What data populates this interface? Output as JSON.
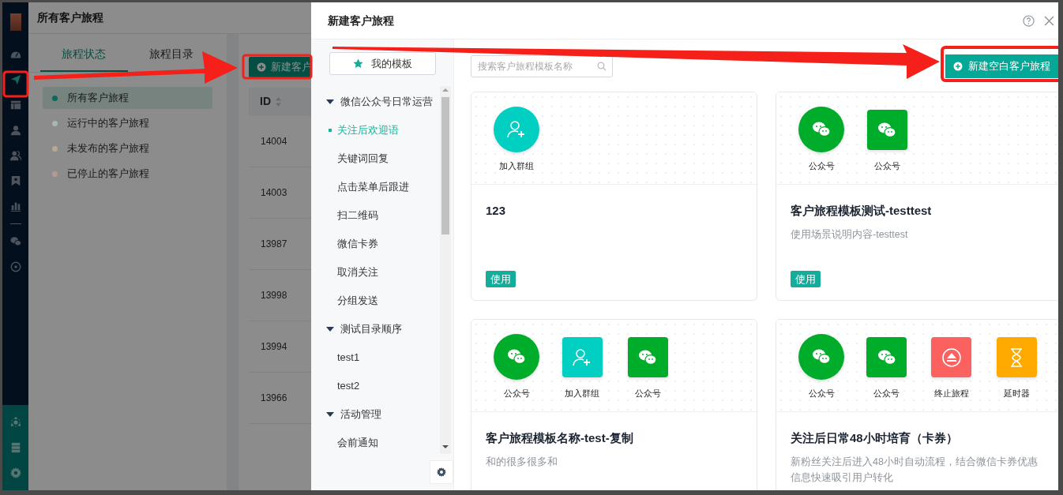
{
  "sidebar": {
    "top_items": [
      {
        "kind": "gauge",
        "selected": false
      },
      {
        "kind": "send",
        "selected": true
      },
      {
        "kind": "layout",
        "selected": false
      },
      {
        "kind": "user",
        "selected": false
      },
      {
        "kind": "users",
        "selected": false
      },
      {
        "kind": "bookmark",
        "selected": false
      },
      {
        "kind": "chart",
        "selected": false
      }
    ],
    "lower_items": [
      {
        "kind": "wechat",
        "selected": false
      },
      {
        "kind": "target",
        "selected": false
      }
    ],
    "bottom_items": [
      {
        "kind": "network",
        "selected": false
      },
      {
        "kind": "server",
        "selected": false
      },
      {
        "kind": "settings",
        "selected": false
      }
    ]
  },
  "page_title": "所有客户旅程",
  "tabs": [
    {
      "label": "旅程状态",
      "selected": true
    },
    {
      "label": "旅程目录",
      "selected": false
    }
  ],
  "status_list": [
    {
      "label": "所有客户旅程",
      "selected": true,
      "color": "#0b6a5c"
    },
    {
      "label": "运行中的客户旅程",
      "selected": false,
      "color": "#a8b8b0"
    },
    {
      "label": "未发布的客户旅程",
      "selected": false,
      "color": "#b7a991"
    },
    {
      "label": "已停止的客户旅程",
      "selected": false,
      "color": "#b39a94"
    }
  ],
  "new_button": "新建客户",
  "table": {
    "columns": [
      "ID"
    ],
    "rows": [
      [
        "14004"
      ],
      [
        "14003"
      ],
      [
        "13987"
      ],
      [
        "13998"
      ],
      [
        "13994"
      ],
      [
        "13966"
      ]
    ]
  },
  "modal": {
    "title": "新建客户旅程",
    "my_templates_button": "我的模板",
    "tree": [
      {
        "label": "微信公众号日常运营",
        "expanded": true,
        "children": [
          {
            "label": "关注后欢迎语",
            "selected": true
          },
          {
            "label": "关键词回复",
            "selected": false
          },
          {
            "label": "点击菜单后跟进",
            "selected": false
          },
          {
            "label": "扫二维码",
            "selected": false
          },
          {
            "label": "微信卡券",
            "selected": false
          },
          {
            "label": "取消关注",
            "selected": false
          },
          {
            "label": "分组发送",
            "selected": false
          }
        ]
      },
      {
        "label": "测试目录顺序",
        "expanded": true,
        "children": [
          {
            "label": "test1",
            "selected": false
          },
          {
            "label": "test2",
            "selected": false
          }
        ]
      },
      {
        "label": "活动管理",
        "expanded": true,
        "children": [
          {
            "label": "会前通知",
            "selected": false
          }
        ]
      }
    ],
    "search": {
      "placeholder": "搜索客户旅程模板名称"
    },
    "new_blank_button": "新建空白客户旅程",
    "templates": [
      {
        "nodes": [
          {
            "kind": "group",
            "round": true,
            "label": "加入群组"
          }
        ],
        "title": "123",
        "use_button": "使用"
      },
      {
        "nodes": [
          {
            "kind": "wechat",
            "round": true,
            "label": "公众号"
          },
          {
            "kind": "wechat",
            "round": false,
            "label": "公众号"
          }
        ],
        "title": "客户旅程模板测试-testtest",
        "description": "使用场景说明内容-testtest",
        "use_button": "使用"
      },
      {
        "nodes": [
          {
            "kind": "wechat",
            "round": true,
            "label": "公众号"
          },
          {
            "kind": "group",
            "round": false,
            "label": "加入群组"
          },
          {
            "kind": "wechat",
            "round": false,
            "label": "公众号"
          }
        ],
        "title": "客户旅程模板名称-test-复制",
        "description": "和的很多很多和"
      },
      {
        "nodes": [
          {
            "kind": "wechat",
            "round": true,
            "label": "公众号"
          },
          {
            "kind": "wechat",
            "round": false,
            "label": "公众号"
          },
          {
            "kind": "stop",
            "round": false,
            "label": "终止旅程"
          },
          {
            "kind": "timer",
            "round": false,
            "label": "延时器"
          }
        ],
        "title": "关注后日常48小时培育（卡券）",
        "description": "新粉丝关注后进入48小时自动流程，结合微信卡券优惠信息快速吸引用户转化"
      }
    ]
  }
}
